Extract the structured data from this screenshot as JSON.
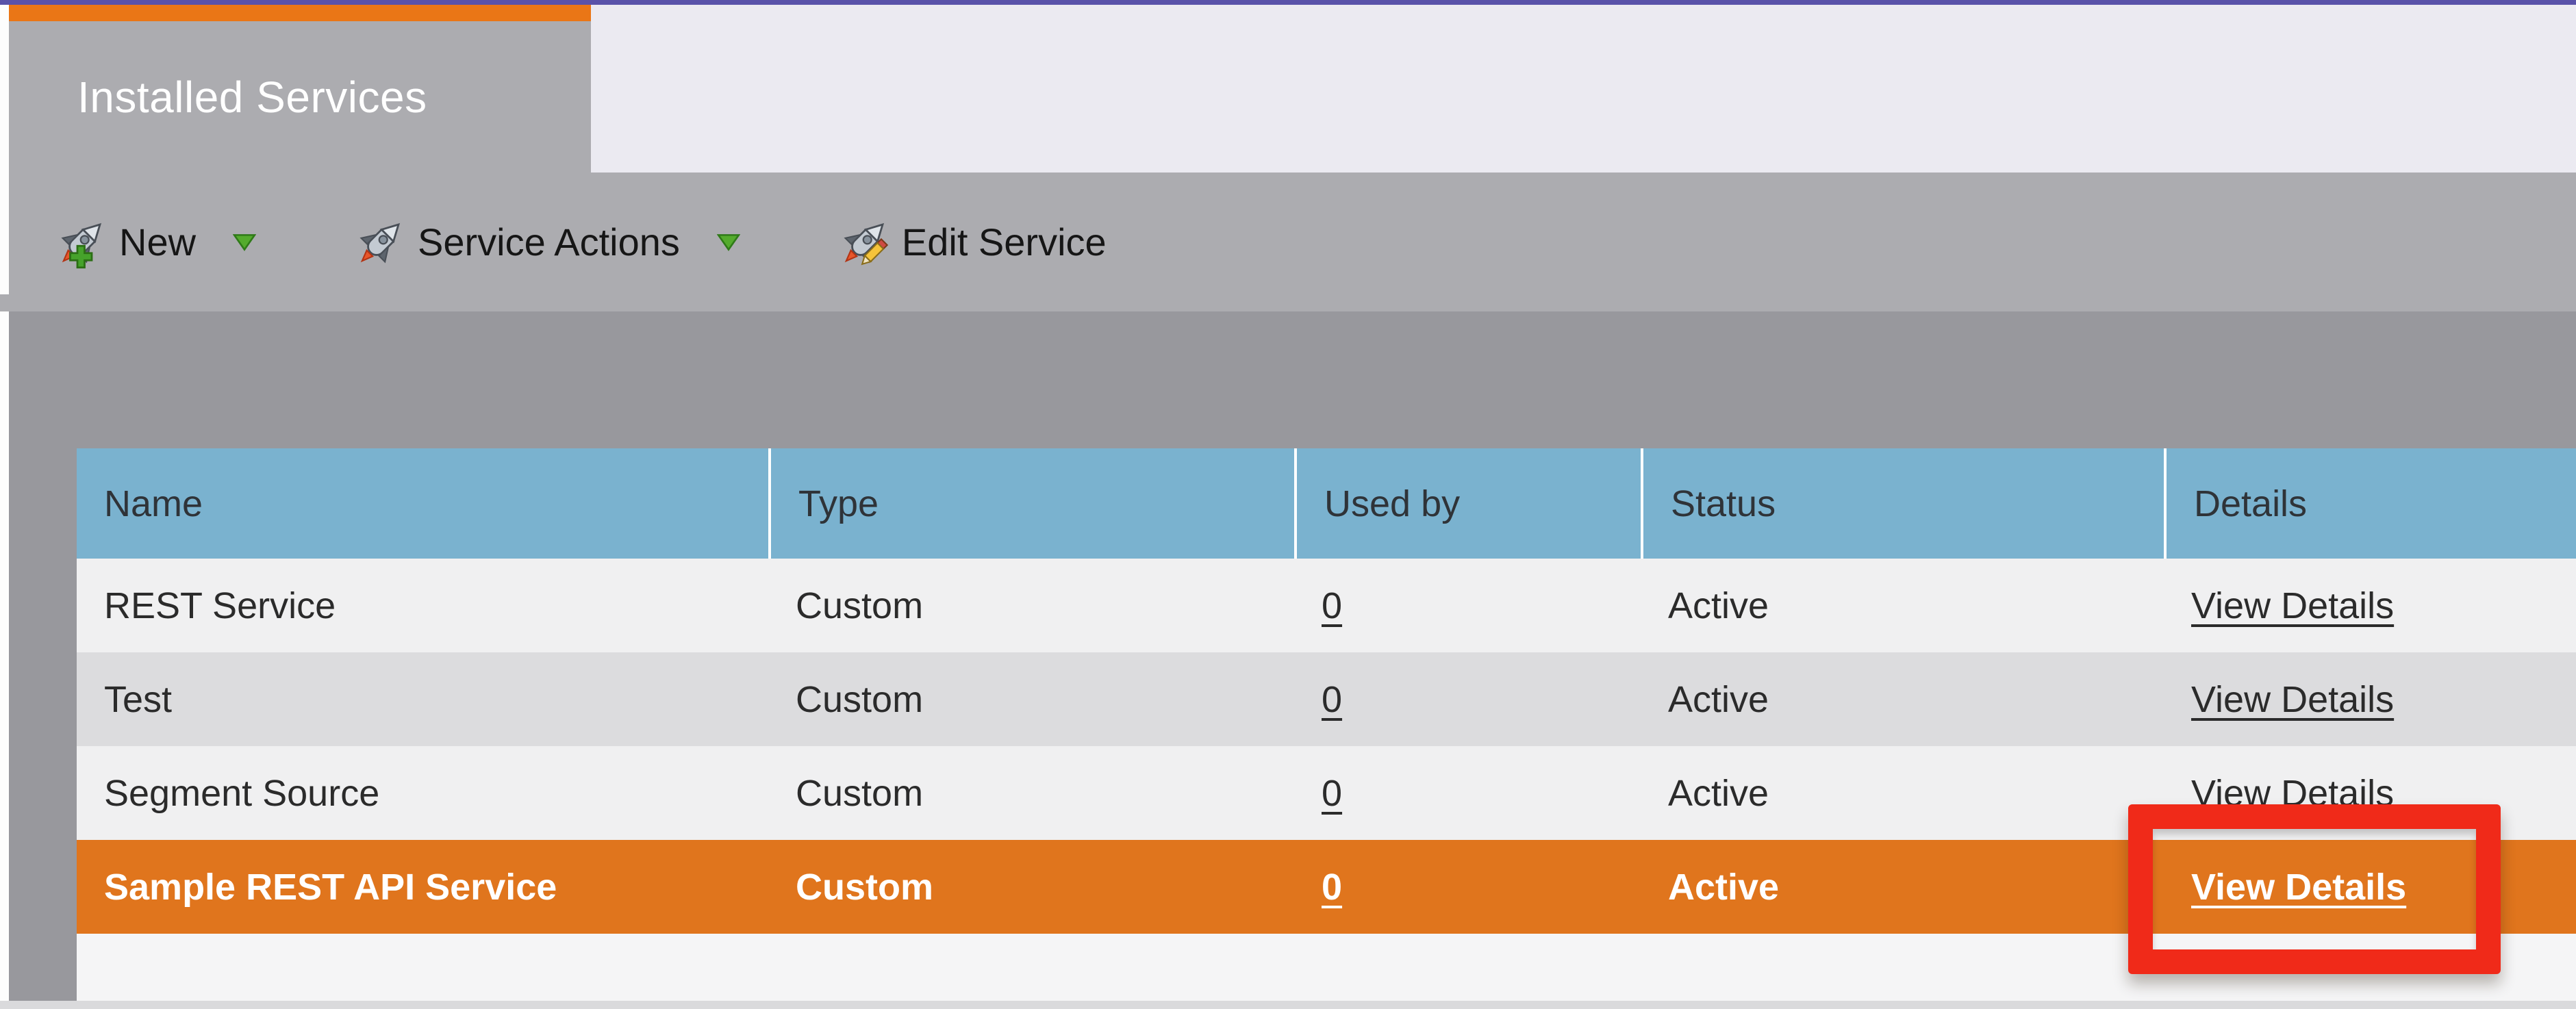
{
  "window": {
    "top_accent_color": "#5952A9"
  },
  "tab": {
    "title": "Installed Services",
    "accent_color": "#EA7616",
    "background_color": "#ACACB0"
  },
  "toolbar": {
    "background_color": "#ACACB0",
    "buttons": [
      {
        "label": "New",
        "icon": "rocket-add-icon",
        "has_dropdown": true
      },
      {
        "label": "Service Actions",
        "icon": "rocket-icon",
        "has_dropdown": true
      },
      {
        "label": "Edit Service",
        "icon": "rocket-edit-icon",
        "has_dropdown": false
      }
    ],
    "dropdown_caret_color": "#54AB2D"
  },
  "table": {
    "header_background": "#7AB2CF",
    "highlight_color": "#E0751D",
    "columns": [
      "Name",
      "Type",
      "Used by",
      "Status",
      "Details"
    ],
    "rows": [
      {
        "name": "REST Service",
        "type": "Custom",
        "used_by": "0",
        "status": "Active",
        "details": "View Details",
        "highlighted": false
      },
      {
        "name": "Test",
        "type": "Custom",
        "used_by": "0",
        "status": "Active",
        "details": "View Details",
        "highlighted": false
      },
      {
        "name": "Segment Source",
        "type": "Custom",
        "used_by": "0",
        "status": "Active",
        "details": "View Details",
        "highlighted": false
      },
      {
        "name": "Sample REST API Service",
        "type": "Custom",
        "used_by": "0",
        "status": "Active",
        "details": "View Details",
        "highlighted": true
      }
    ]
  },
  "annotation": {
    "shape": "rectangle",
    "color": "#F02A19",
    "target": "View Details"
  }
}
